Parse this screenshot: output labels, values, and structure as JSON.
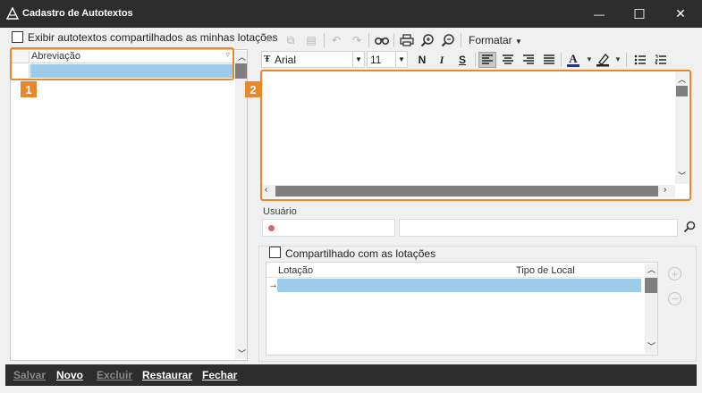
{
  "window": {
    "title": "Cadastro de Autotextos",
    "controls": {
      "minimize": "—",
      "maximize": "☐",
      "close": "✕"
    }
  },
  "left": {
    "checkbox_label": "Exibir autotextos compartilhados as minhas lotações",
    "column_header": "Abreviação",
    "badge": "1"
  },
  "editor": {
    "badge": "2",
    "format_menu": "Formatar",
    "font_name": "Arial",
    "font_size": "11",
    "bold": "N",
    "italic": "I",
    "underline": "S",
    "font_color_letter": "A"
  },
  "usuario": {
    "label": "Usuário"
  },
  "shared": {
    "checkbox_label": "Compartilhado com as lotações",
    "columns": [
      "Lotação",
      "Tipo de Local"
    ]
  },
  "footer": {
    "salvar": "Salvar",
    "novo": "Novo",
    "excluir": "Excluir",
    "restaurar": "Restaurar",
    "fechar": "Fechar"
  },
  "colors": {
    "accent": "#e8882a",
    "selection": "#9ecbea",
    "titlebar": "#2d2d2d"
  }
}
